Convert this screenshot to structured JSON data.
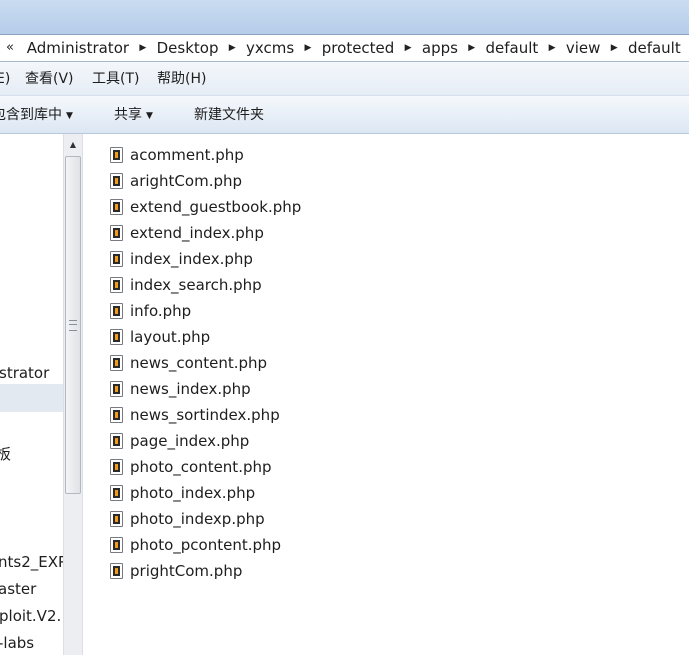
{
  "address_bar": {
    "overflow_label": "«",
    "segments": [
      "Administrator",
      "Desktop",
      "yxcms",
      "protected",
      "apps",
      "default",
      "view",
      "default"
    ],
    "separator": "▶"
  },
  "menu": {
    "items": [
      "E)",
      "查看(V)",
      "工具(T)",
      "帮助(H)"
    ]
  },
  "toolbar": {
    "include_label": "包含到库中",
    "share_label": "共享",
    "new_folder_label": "新建文件夹",
    "dropdown_caret": "▼"
  },
  "nav_pane": {
    "items": [
      "strator",
      "板",
      "nts2_EXP",
      "aster",
      "ploit.V2.",
      "-labs"
    ]
  },
  "scrollbar": {
    "up_arrow": "▲"
  },
  "files": [
    "acomment.php",
    "arightCom.php",
    "extend_guestbook.php",
    "extend_index.php",
    "index_index.php",
    "index_search.php",
    "info.php",
    "layout.php",
    "news_content.php",
    "news_index.php",
    "news_sortindex.php",
    "page_index.php",
    "photo_content.php",
    "photo_index.php",
    "photo_indexp.php",
    "photo_pcontent.php",
    "prightCom.php"
  ]
}
